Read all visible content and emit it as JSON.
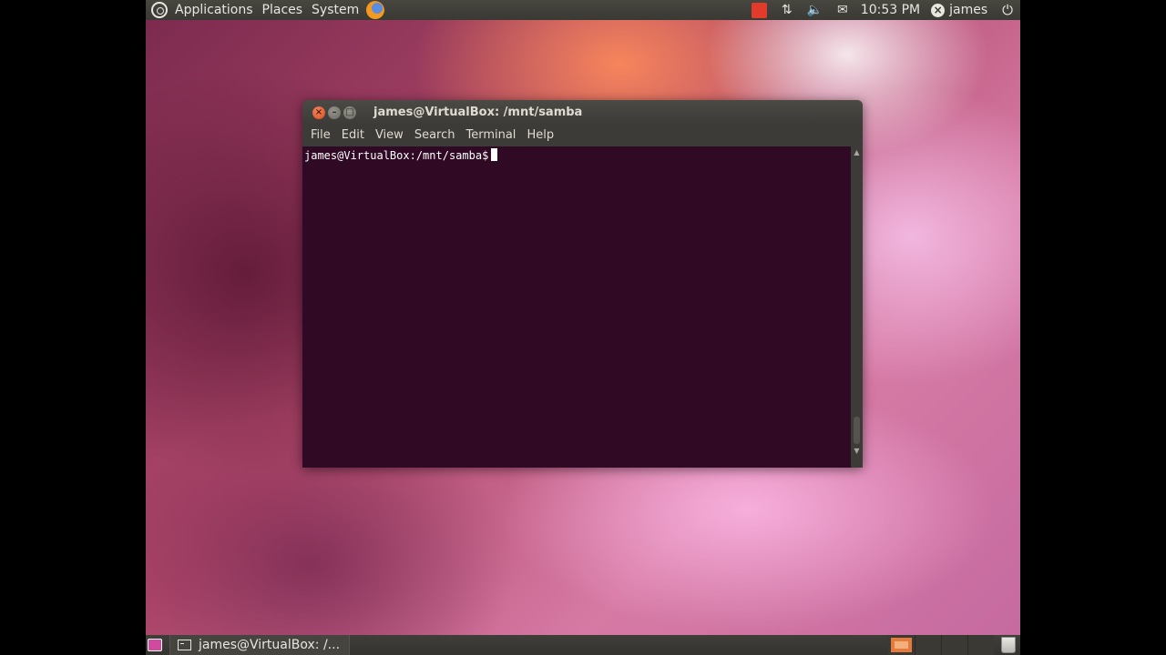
{
  "top_panel": {
    "menus": [
      "Applications",
      "Places",
      "System"
    ],
    "clock": "10:53 PM",
    "username": "james"
  },
  "terminal": {
    "title": "james@VirtualBox: /mnt/samba",
    "menu": [
      "File",
      "Edit",
      "View",
      "Search",
      "Terminal",
      "Help"
    ],
    "prompt": "james@VirtualBox:/mnt/samba$"
  },
  "bottom_panel": {
    "task_label": "james@VirtualBox: /..."
  },
  "colors": {
    "terminal_bg": "#300a24",
    "panel_bg": "#3c3b37",
    "close_button": "#e0552b",
    "workspace_active": "#e47b3c"
  }
}
